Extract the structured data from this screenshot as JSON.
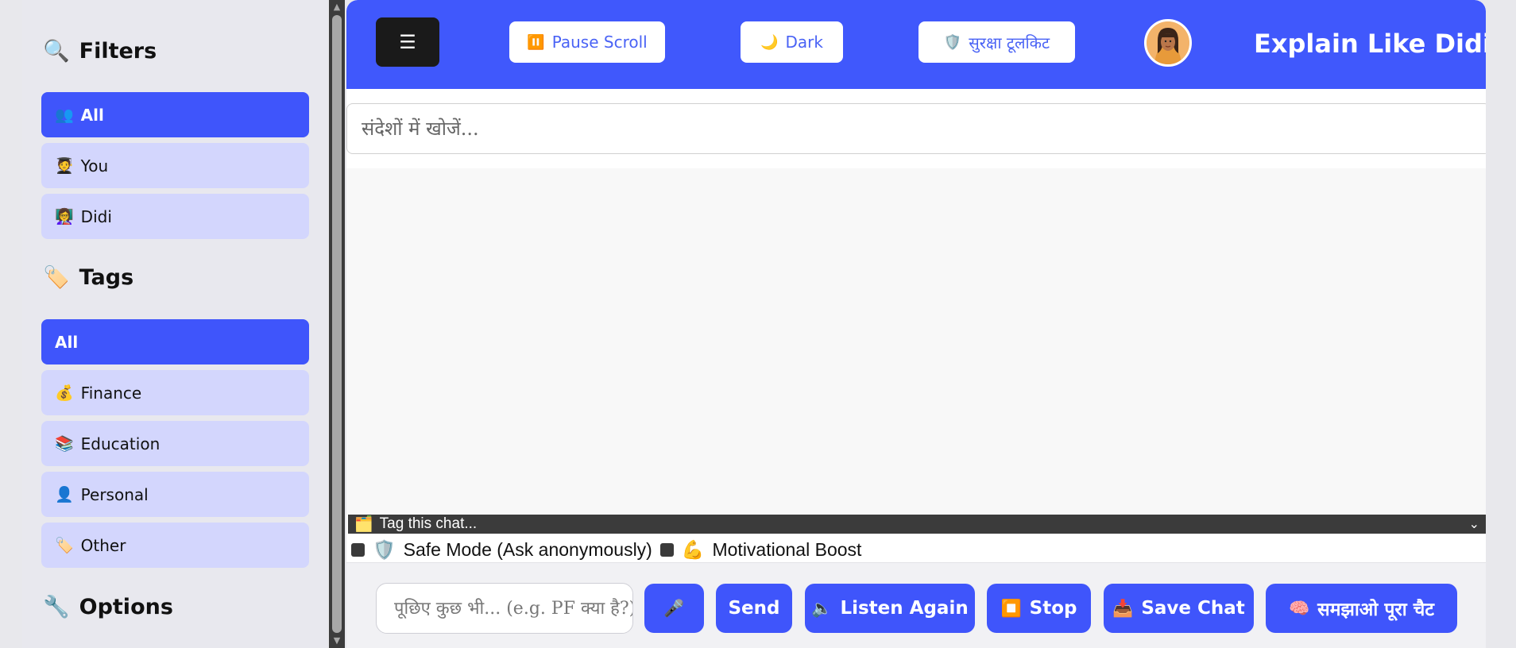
{
  "sidebar": {
    "filters_title": "Filters",
    "filters_icon": "🔍",
    "filters": [
      {
        "icon": "👥",
        "label": "All",
        "active": true
      },
      {
        "icon": "🧑‍🎓",
        "label": "You",
        "active": false
      },
      {
        "icon": "👩‍🏫",
        "label": "Didi",
        "active": false
      }
    ],
    "tags_title": "Tags",
    "tags_icon": "🏷️",
    "tags": [
      {
        "icon": "",
        "label": "All",
        "active": true
      },
      {
        "icon": "💰",
        "label": "Finance",
        "active": false
      },
      {
        "icon": "📚",
        "label": "Education",
        "active": false
      },
      {
        "icon": "👤",
        "label": "Personal",
        "active": false
      },
      {
        "icon": "🏷️",
        "label": "Other",
        "active": false
      }
    ],
    "options_title": "Options",
    "options_icon": "🔧"
  },
  "header": {
    "menu_label": "☰",
    "pause_icon": "⏸️",
    "pause_label": "Pause Scroll",
    "dark_icon": "🌙",
    "dark_label": "Dark",
    "toolkit_icon": "🛡️",
    "toolkit_label": "सुरक्षा टूलकिट",
    "brand": "Explain Like Didi"
  },
  "search": {
    "placeholder": "संदेशों में खोजें..."
  },
  "tag_select": {
    "icon": "🗂️",
    "label": "Tag this chat..."
  },
  "options": {
    "safe_mode_icon": "🛡️",
    "safe_mode_label": "Safe Mode (Ask anonymously)",
    "boost_icon": "💪",
    "boost_label": "Motivational Boost"
  },
  "composer": {
    "placeholder": "पूछिए कुछ भी... (e.g. PF क्या है?)",
    "mic_icon": "🎤",
    "send_label": "Send",
    "listen_icon": "🔈",
    "listen_label": "Listen Again",
    "stop_icon": "⏹️",
    "stop_label": "Stop",
    "save_icon": "📥",
    "save_label": "Save Chat",
    "explain_icon": "🧠",
    "explain_label": "समझाओ पूरा चैट"
  },
  "colors": {
    "accent": "#4058fc",
    "active_filter": "#3f55fb",
    "inactive_filter": "#d3d6fd"
  }
}
